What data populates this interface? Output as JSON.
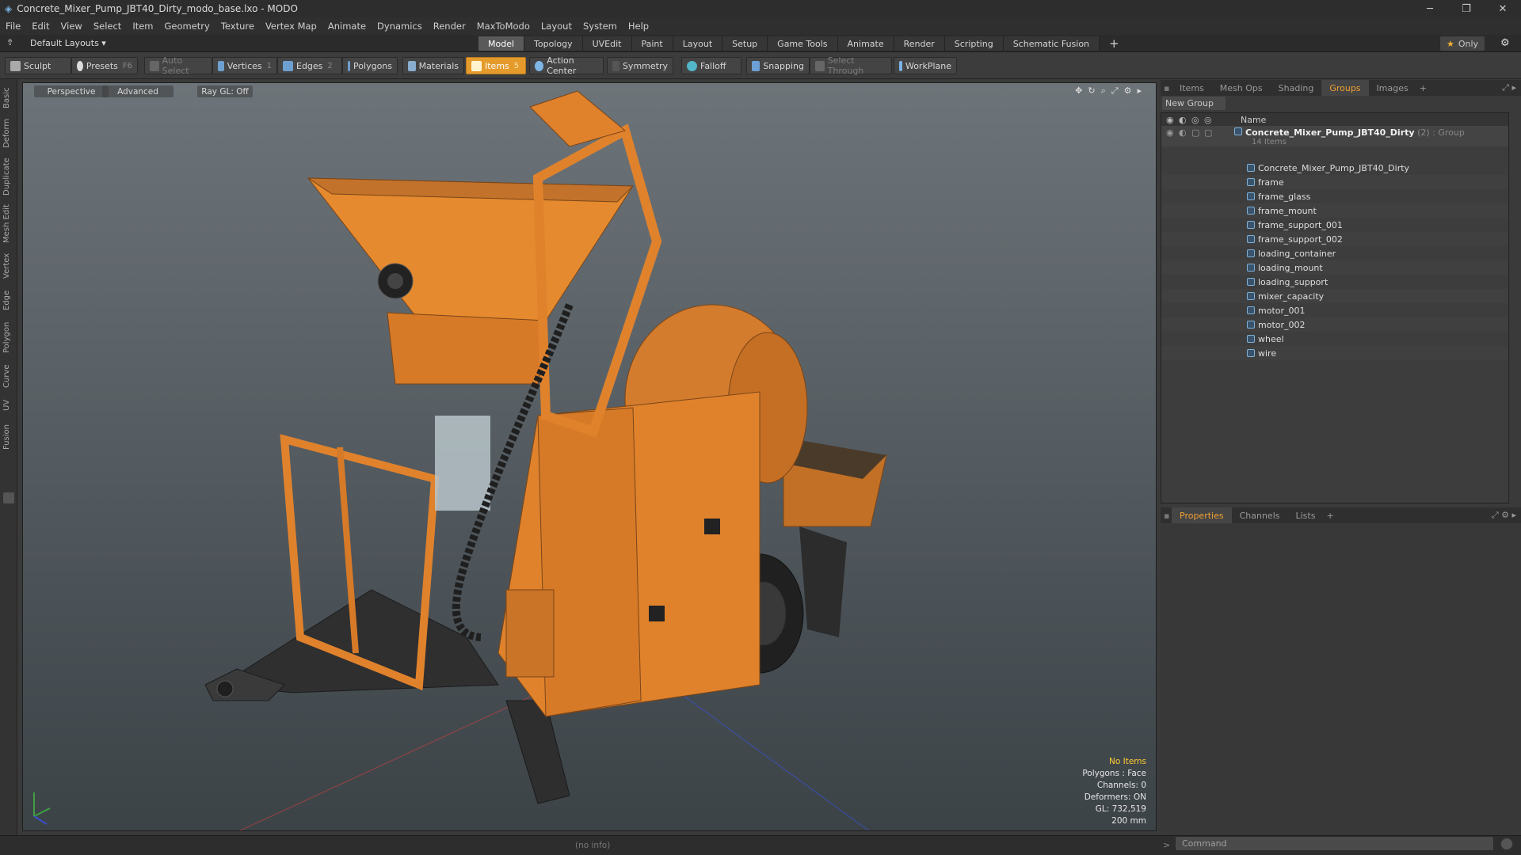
{
  "window": {
    "title": "Concrete_Mixer_Pump_JBT40_Dirty_modo_base.lxo - MODO"
  },
  "menu": [
    "File",
    "Edit",
    "View",
    "Select",
    "Item",
    "Geometry",
    "Texture",
    "Vertex Map",
    "Animate",
    "Dynamics",
    "Render",
    "MaxToModo",
    "Layout",
    "System",
    "Help"
  ],
  "layout": {
    "preset": "Default Layouts ▾",
    "only_label": "Only"
  },
  "layout_tabs": [
    "Model",
    "Topology",
    "UVEdit",
    "Paint",
    "Layout",
    "Setup",
    "Game Tools",
    "Animate",
    "Render",
    "Scripting",
    "Schematic Fusion"
  ],
  "toolbar": {
    "sculpt": "Sculpt",
    "presets": "Presets",
    "presets_key": "F6",
    "auto_select": "Auto Select",
    "vertices": "Vertices",
    "vertices_key": "1",
    "edges": "Edges",
    "edges_key": "2",
    "polygons": "Polygons",
    "materials": "Materials",
    "items": "Items",
    "items_key": "5",
    "action_center": "Action Center",
    "symmetry": "Symmetry",
    "falloff": "Falloff",
    "snapping": "Snapping",
    "select_through": "Select Through",
    "workplane": "WorkPlane"
  },
  "left_tabs": [
    "Basic",
    "Deform",
    "Duplicate",
    "Mesh Edit",
    "Vertex",
    "Edge",
    "Polygon",
    "Curve",
    "UV",
    "Fusion"
  ],
  "viewport": {
    "perspective": "Perspective",
    "advanced": "Advanced",
    "raygl": "Ray GL: Off",
    "stats": {
      "selection": "No Items",
      "polygons": "Polygons : Face",
      "channels": "Channels: 0",
      "deformers": "Deformers: ON",
      "gl": "GL: 732,519",
      "scale": "200 mm"
    }
  },
  "top_panel": {
    "tabs": [
      "Items",
      "Mesh Ops",
      "Shading",
      "Groups",
      "Images"
    ],
    "active_tab": "Groups",
    "new_group": "New Group",
    "name_header": "Name",
    "group_name": "Concrete_Mixer_Pump_JBT40_Dirty",
    "group_suffix": "(2) : Group",
    "group_count": "14 Items",
    "items": [
      "Concrete_Mixer_Pump_JBT40_Dirty",
      "frame",
      "frame_glass",
      "frame_mount",
      "frame_support_001",
      "frame_support_002",
      "loading_container",
      "loading_mount",
      "loading_support",
      "mixer_capacity",
      "motor_001",
      "motor_002",
      "wheel",
      "wire"
    ]
  },
  "bottom_panel": {
    "tabs": [
      "Properties",
      "Channels",
      "Lists"
    ]
  },
  "status": {
    "info": "(no info)",
    "command_placeholder": "Command"
  },
  "colors": {
    "accent": "#e59b2c",
    "mixer_orange": "#e8842a"
  }
}
